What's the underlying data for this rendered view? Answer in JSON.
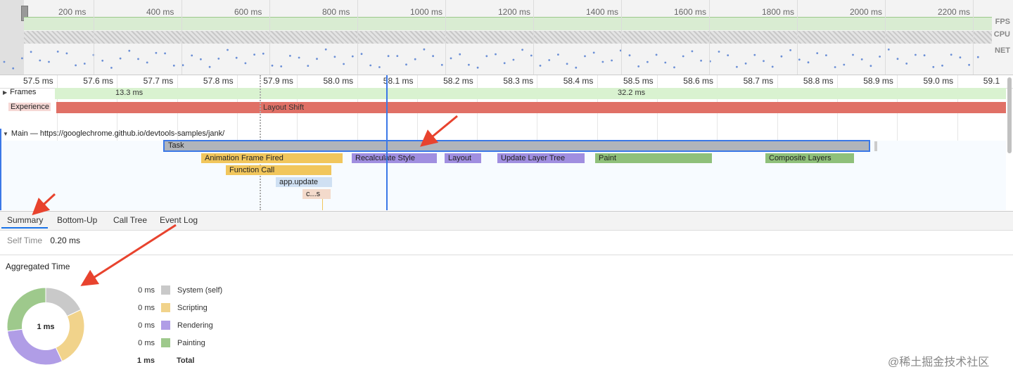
{
  "overview": {
    "ticks": [
      "200 ms",
      "400 ms",
      "600 ms",
      "800 ms",
      "1000 ms",
      "1200 ms",
      "1400 ms",
      "1600 ms",
      "1800 ms",
      "2000 ms",
      "2200 ms"
    ],
    "fps_label": "FPS",
    "cpu_label": "CPU",
    "net_label": "NET"
  },
  "ruler": {
    "ticks": [
      "57.5 ms",
      "57.6 ms",
      "57.7 ms",
      "57.8 ms",
      "57.9 ms",
      "58.0 ms",
      "58.1 ms",
      "58.2 ms",
      "58.3 ms",
      "58.4 ms",
      "58.5 ms",
      "58.6 ms",
      "58.7 ms",
      "58.8 ms",
      "58.9 ms",
      "59.0 ms",
      "59.1"
    ]
  },
  "tracks": {
    "frames": {
      "label": "Frames",
      "frame1": "13.3 ms",
      "frame2": "32.2 ms"
    },
    "experience": {
      "label": "Experience",
      "event": "Layout Shift"
    },
    "main": {
      "label": "Main — https://googlechrome.github.io/devtools-samples/jank/",
      "task": "Task",
      "animation": "Animation Frame Fired",
      "recalc": "Recalculate Style",
      "layout": "Layout",
      "update_layer": "Update Layer Tree",
      "paint": "Paint",
      "composite": "Composite Layers",
      "function_call": "Function Call",
      "app_update": "app.update",
      "cs": "c...s"
    }
  },
  "tabs": {
    "summary": "Summary",
    "bottom_up": "Bottom-Up",
    "call_tree": "Call Tree",
    "event_log": "Event Log"
  },
  "summary": {
    "self_time_label": "Self Time",
    "self_time_value": "0.20 ms",
    "aggregated_title": "Aggregated Time",
    "donut_center": "1 ms",
    "legend": [
      {
        "value": "0 ms",
        "name": "System (self)",
        "color": "#c9c9c9"
      },
      {
        "value": "0 ms",
        "name": "Scripting",
        "color": "#f1d38b"
      },
      {
        "value": "0 ms",
        "name": "Rendering",
        "color": "#b09de6"
      },
      {
        "value": "0 ms",
        "name": "Painting",
        "color": "#9ec98c"
      }
    ],
    "total_value": "1 ms",
    "total_label": "Total",
    "donut_fractions": [
      0.18,
      0.25,
      0.3,
      0.27
    ]
  },
  "watermark": "@稀土掘金技术社区",
  "colors": {
    "accent": "#3b78e7",
    "layout_shift": "#e07066",
    "frames": "#d9f2d0",
    "scripting": "#f1d38b",
    "rendering": "#b09de6",
    "painting": "#9ec98c",
    "system": "#b0b4ba",
    "arrow": "#e8432e"
  }
}
